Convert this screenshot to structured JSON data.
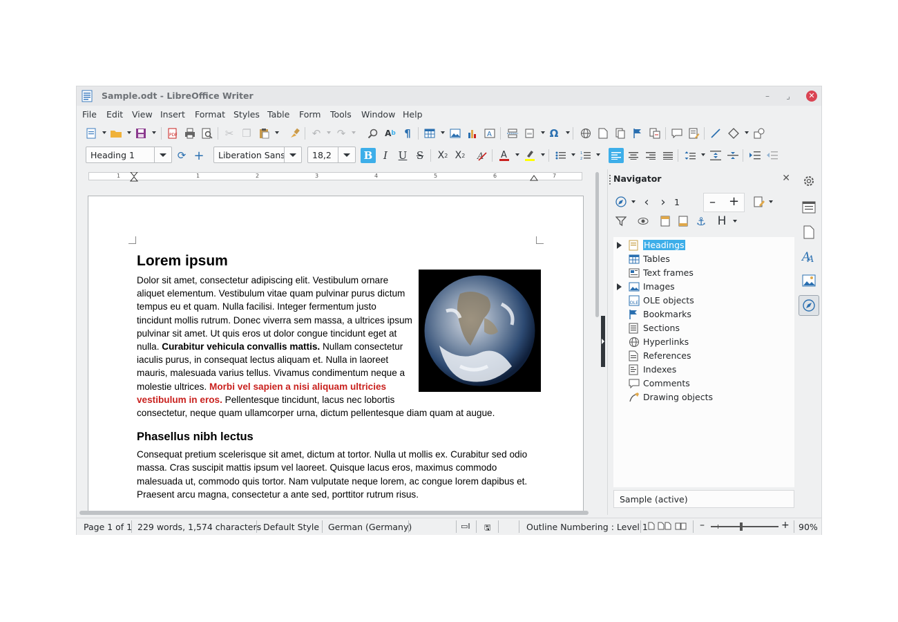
{
  "window": {
    "title": "Sample.odt - LibreOffice Writer",
    "controls": [
      "minimize-icon",
      "maximize-icon",
      "close-icon"
    ]
  },
  "menubar": [
    "File",
    "Edit",
    "View",
    "Insert",
    "Format",
    "Styles",
    "Table",
    "Form",
    "Tools",
    "Window",
    "Help"
  ],
  "formatting": {
    "paragraph_style": "Heading 1",
    "font_name": "Liberation Sans",
    "font_size": "18,2",
    "bold_active": true,
    "align_left_active": true
  },
  "ruler": {
    "numbers": [
      "1",
      "1",
      "2",
      "3",
      "4",
      "5",
      "6",
      "7"
    ]
  },
  "document": {
    "heading1": "Lorem ipsum",
    "para1_a": "Dolor sit amet, consectetur adipiscing elit. Vestibulum ornare aliquet elementum. Vestibulum vitae quam pulvinar purus dictum tempus eu et quam. Nulla facilisi. Integer fermentum justo tincidunt mollis rutrum. Donec viverra sem massa, a ultrices ipsum pulvinar sit amet. Ut quis eros ut dolor congue tincidunt eget at nulla. ",
    "para1_bold": "Curabitur vehicula convallis mattis.",
    "para1_b": " Nullam consectetur iaculis purus, in consequat lectus aliquam et. Nulla in laoreet mauris, malesuada varius tellus. Vivamus condimentum neque a molestie ultrices. ",
    "para1_red": "Morbi vel sapien a nisi aliquam ultricies vestibulum in eros.",
    "para1_c": " Pellentesque tincidunt, lacus nec lobortis consectetur, neque quam ullamcorper urna, dictum pellentesque diam quam at augue.",
    "heading2": "Phasellus nibh lectus",
    "para2": "Consequat pretium scelerisque sit amet, dictum at tortor. Nulla ut mollis ex. Curabitur sed odio massa. Cras suscipit mattis ipsum vel laoreet. Quisque lacus eros, maximus commodo malesuada ut, commodo quis tortor. Nam vulputate neque lorem, ac congue lorem dapibus et. Praesent arcu magna, consectetur a ante sed, porttitor rutrum risus."
  },
  "navigator": {
    "title": "Navigator",
    "page_number": "1",
    "items": [
      {
        "label": "Headings",
        "icon": "headings-icon",
        "expandable": true,
        "selected": true
      },
      {
        "label": "Tables",
        "icon": "table-icon",
        "expandable": false
      },
      {
        "label": "Text frames",
        "icon": "text-frame-icon",
        "expandable": false
      },
      {
        "label": "Images",
        "icon": "image-icon",
        "expandable": true
      },
      {
        "label": "OLE objects",
        "icon": "ole-icon",
        "expandable": false
      },
      {
        "label": "Bookmarks",
        "icon": "bookmark-icon",
        "expandable": false
      },
      {
        "label": "Sections",
        "icon": "section-icon",
        "expandable": false
      },
      {
        "label": "Hyperlinks",
        "icon": "hyperlink-icon",
        "expandable": false
      },
      {
        "label": "References",
        "icon": "reference-icon",
        "expandable": false
      },
      {
        "label": "Indexes",
        "icon": "index-icon",
        "expandable": false
      },
      {
        "label": "Comments",
        "icon": "comment-icon",
        "expandable": false
      },
      {
        "label": "Drawing objects",
        "icon": "drawing-icon",
        "expandable": false
      }
    ],
    "document_select": "Sample (active)"
  },
  "statusbar": {
    "page": "Page 1 of 1",
    "words": "229 words, 1,574 characters",
    "page_style": "Default Style",
    "language": "German (Germany)",
    "outline": "Outline Numbering : Level 1",
    "zoom": "90%"
  },
  "colors": {
    "accent": "#3daee9",
    "red_text": "#c9211e",
    "close": "#da4453"
  }
}
